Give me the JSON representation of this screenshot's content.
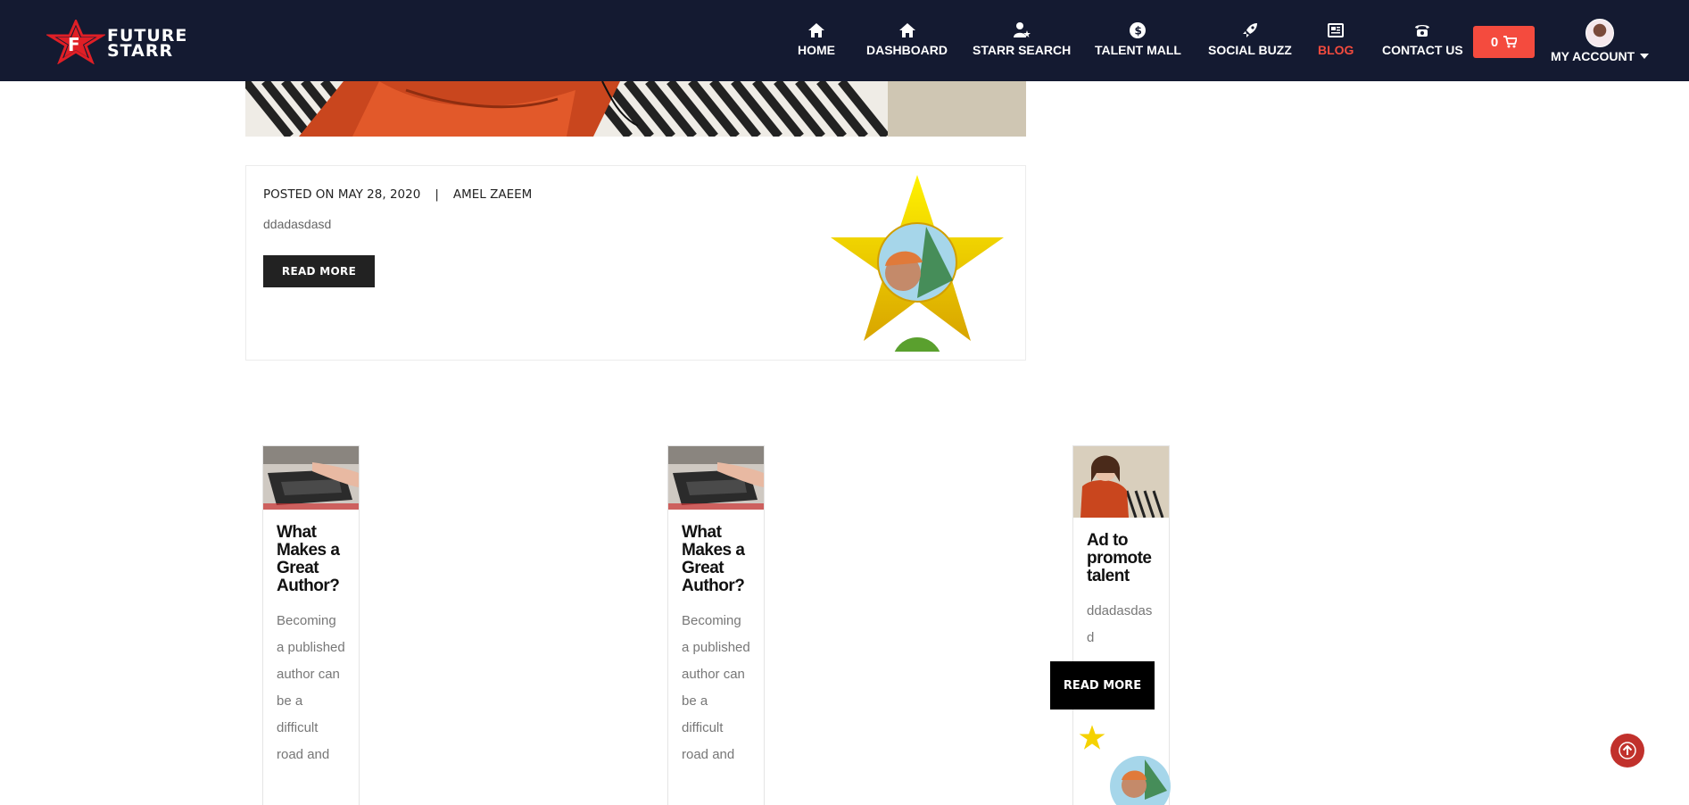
{
  "brand": {
    "line1": "FUTURE",
    "line2": "STARR"
  },
  "nav": {
    "home": "HOME",
    "dashboard": "DASHBOARD",
    "starr_search": "STARR SEARCH",
    "talent_mall": "TALENT MALL",
    "social_buzz": "SOCIAL BUZZ",
    "blog": "BLOG",
    "contact_us": "CONTACT US",
    "cart_count": "0",
    "my_account": "MY ACCOUNT"
  },
  "featured_post": {
    "posted_on": "POSTED ON MAY 28, 2020",
    "separator": "|",
    "author": "AMEL ZAEEM",
    "excerpt": "ddadasdasd",
    "read_more": "READ MORE"
  },
  "cards": [
    {
      "title": "What Makes a Great Author?",
      "excerpt": "Becoming a published author can be a difficult road and"
    },
    {
      "title": "What Makes a Great Author?",
      "excerpt": "Becoming a published author can be a difficult road and"
    },
    {
      "title": "Ad to promote talent",
      "excerpt": "ddadasdasd",
      "read_more": "READ MORE"
    }
  ],
  "colors": {
    "nav_bg": "#141a31",
    "accent": "#f44b3e",
    "scroll_top": "#c1312c"
  }
}
